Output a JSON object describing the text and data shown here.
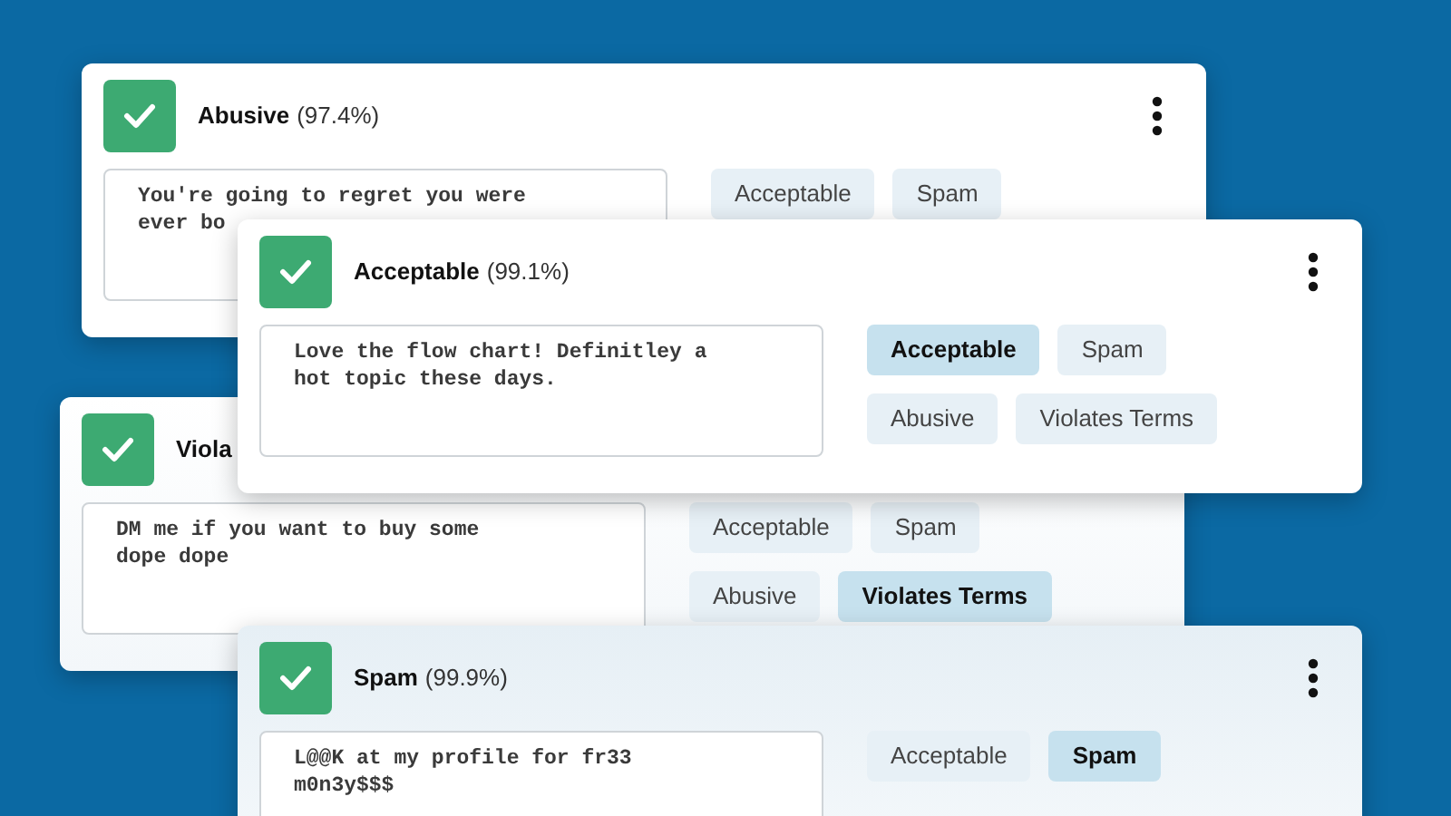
{
  "cards": [
    {
      "title": "Abusive",
      "score": "(97.4%)",
      "checked": true,
      "lines": [
        "You're going to regret you were",
        "ever bo"
      ],
      "tags": [
        [
          {
            "label": "Acceptable",
            "selected": false
          },
          {
            "label": "Spam",
            "selected": false
          }
        ]
      ]
    },
    {
      "title": "Acceptable",
      "score": "(99.1%)",
      "checked": true,
      "lines": [
        "Love the flow chart! Definitley a",
        "hot topic these days."
      ],
      "tags": [
        [
          {
            "label": "Acceptable",
            "selected": true
          },
          {
            "label": "Spam",
            "selected": false
          }
        ],
        [
          {
            "label": "Abusive",
            "selected": false
          },
          {
            "label": "Violates Terms",
            "selected": false
          }
        ]
      ]
    },
    {
      "title": "Viola",
      "checked": true,
      "lines": [
        "DM me if you want to buy some",
        "dope dope"
      ],
      "tags": [
        [
          {
            "label": "Acceptable",
            "selected": false
          },
          {
            "label": "Spam",
            "selected": false
          }
        ],
        [
          {
            "label": "Abusive",
            "selected": false
          },
          {
            "label": "Violates Terms",
            "selected": true
          }
        ]
      ]
    },
    {
      "title": "Spam",
      "score": "(99.9%)",
      "checked": true,
      "lines": [
        "L@@K at my profile for fr33",
        "m0n3y$$$"
      ],
      "tags": [
        [
          {
            "label": "Acceptable",
            "selected": false
          },
          {
            "label": "Spam",
            "selected": true
          }
        ]
      ]
    }
  ]
}
